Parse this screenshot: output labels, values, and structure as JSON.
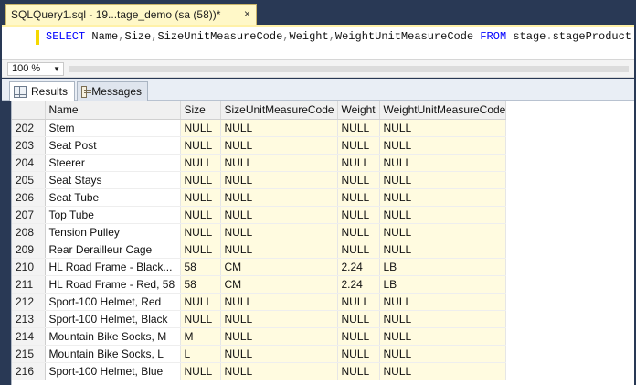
{
  "document_tab": {
    "title": "SQLQuery1.sql - 19...tage_demo (sa (58))*",
    "close_glyph": "×"
  },
  "editor": {
    "tokens": [
      {
        "t": "SELECT",
        "c": "kw"
      },
      {
        "t": " ",
        "c": "id"
      },
      {
        "t": "Name",
        "c": "id"
      },
      {
        "t": ",",
        "c": "pn"
      },
      {
        "t": "Size",
        "c": "id"
      },
      {
        "t": ",",
        "c": "pn"
      },
      {
        "t": "SizeUnitMeasureCode",
        "c": "id"
      },
      {
        "t": ",",
        "c": "pn"
      },
      {
        "t": "Weight",
        "c": "id"
      },
      {
        "t": ",",
        "c": "pn"
      },
      {
        "t": "WeightUnitMeasureCode",
        "c": "id"
      },
      {
        "t": " ",
        "c": "id"
      },
      {
        "t": "FROM",
        "c": "kw"
      },
      {
        "t": " ",
        "c": "id"
      },
      {
        "t": "stage",
        "c": "id"
      },
      {
        "t": ".",
        "c": "pn"
      },
      {
        "t": "stageProduct",
        "c": "id"
      }
    ]
  },
  "zoom": {
    "value": "100 %"
  },
  "results_tabs": {
    "results_label": "Results",
    "messages_label": "Messages"
  },
  "grid": {
    "columns": [
      "Name",
      "Size",
      "SizeUnitMeasureCode",
      "Weight",
      "WeightUnitMeasureCode"
    ],
    "rows": [
      {
        "n": "202",
        "cells": [
          "Stem",
          "NULL",
          "NULL",
          "NULL",
          "NULL"
        ]
      },
      {
        "n": "203",
        "cells": [
          "Seat Post",
          "NULL",
          "NULL",
          "NULL",
          "NULL"
        ]
      },
      {
        "n": "204",
        "cells": [
          "Steerer",
          "NULL",
          "NULL",
          "NULL",
          "NULL"
        ]
      },
      {
        "n": "205",
        "cells": [
          "Seat Stays",
          "NULL",
          "NULL",
          "NULL",
          "NULL"
        ]
      },
      {
        "n": "206",
        "cells": [
          "Seat Tube",
          "NULL",
          "NULL",
          "NULL",
          "NULL"
        ]
      },
      {
        "n": "207",
        "cells": [
          "Top Tube",
          "NULL",
          "NULL",
          "NULL",
          "NULL"
        ]
      },
      {
        "n": "208",
        "cells": [
          "Tension Pulley",
          "NULL",
          "NULL",
          "NULL",
          "NULL"
        ]
      },
      {
        "n": "209",
        "cells": [
          "Rear Derailleur Cage",
          "NULL",
          "NULL",
          "NULL",
          "NULL"
        ]
      },
      {
        "n": "210",
        "cells": [
          "HL Road Frame - Black...",
          "58",
          "CM",
          "2.24",
          "LB"
        ]
      },
      {
        "n": "211",
        "cells": [
          "HL Road Frame - Red, 58",
          "58",
          "CM",
          "2.24",
          "LB"
        ]
      },
      {
        "n": "212",
        "cells": [
          "Sport-100 Helmet, Red",
          "NULL",
          "NULL",
          "NULL",
          "NULL"
        ]
      },
      {
        "n": "213",
        "cells": [
          "Sport-100 Helmet, Black",
          "NULL",
          "NULL",
          "NULL",
          "NULL"
        ]
      },
      {
        "n": "214",
        "cells": [
          "Mountain Bike Socks, M",
          "M",
          "NULL",
          "NULL",
          "NULL"
        ]
      },
      {
        "n": "215",
        "cells": [
          "Mountain Bike Socks, L",
          "L",
          "NULL",
          "NULL",
          "NULL"
        ]
      },
      {
        "n": "216",
        "cells": [
          "Sport-100 Helmet, Blue",
          "NULL",
          "NULL",
          "NULL",
          "NULL"
        ]
      }
    ]
  }
}
